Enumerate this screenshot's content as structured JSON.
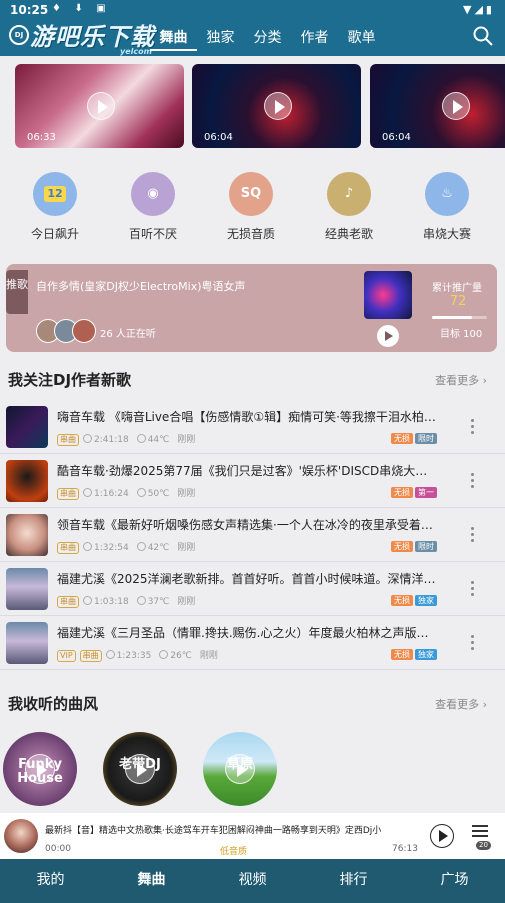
{
  "status_bar": {
    "time": "10:25",
    "left_icons": "♦ ⬇ ▣",
    "right_icons": "▼◢▮"
  },
  "header": {
    "logo_text": "DJ",
    "watermark": "游吧乐下载",
    "watermark_sub": "yelcom",
    "tabs": [
      {
        "label": "舞曲",
        "active": true
      },
      {
        "label": "独家",
        "active": false
      },
      {
        "label": "分类",
        "active": false
      },
      {
        "label": "作者",
        "active": false
      },
      {
        "label": "歌单",
        "active": false
      }
    ]
  },
  "videos": [
    {
      "duration": "06:33"
    },
    {
      "duration": "06:04"
    },
    {
      "duration": "06:04"
    }
  ],
  "categories": [
    {
      "label": "今日飙升",
      "icon": "calendar-12-icon",
      "glyph": "12",
      "color": "#8fb6e8"
    },
    {
      "label": "百听不厌",
      "icon": "vinyl-disc-icon",
      "glyph": "◉",
      "color": "#b9a3d4"
    },
    {
      "label": "无损音质",
      "icon": "sq-headphones-icon",
      "glyph": "SQ",
      "color": "#e3a28a"
    },
    {
      "label": "经典老歌",
      "icon": "gramophone-icon",
      "glyph": "♪",
      "color": "#c9b070"
    },
    {
      "label": "串烧大赛",
      "icon": "flame-icon",
      "glyph": "♨",
      "color": "#8fb6e8"
    }
  ],
  "recommend": {
    "tag": "推歌",
    "title": "自作多情(皇家DJ权少ElectroMix)粤语女声",
    "listening": "26 人正在听",
    "stat_label": "累计推广量",
    "stat_value": "72",
    "target": "目标 100",
    "progress": 0.72
  },
  "followed": {
    "title": "我关注DJ作者新歌",
    "more": "查看更多"
  },
  "songs": [
    {
      "title": "嗨音车载 《嗨音Live合唱【伤感情歌①辑】痴情可笑·等我擦干泪水柏林...",
      "badge": "串曲",
      "duration": "2:41:18",
      "temp": "44℃",
      "time": "刚刚",
      "tags": [
        {
          "t": "无损",
          "c": "#f08a4b"
        },
        {
          "t": "限时",
          "c": "#6b8fa8"
        }
      ]
    },
    {
      "title": "酷音车载·劲爆2025第77届《我们只是过客》'娱乐杯'DISCD串烧大赛·Dj...",
      "badge": "串曲",
      "duration": "1:16:24",
      "temp": "50℃",
      "time": "刚刚",
      "tags": [
        {
          "t": "无损",
          "c": "#f08a4b"
        },
        {
          "t": "第一",
          "c": "#c8509a"
        }
      ]
    },
    {
      "title": "领音车载《最新好听烟嗓伤感女声精选集·一个人在冰冷的夜里承受着孤...",
      "badge": "串曲",
      "duration": "1:32:54",
      "temp": "42℃",
      "time": "刚刚",
      "tags": [
        {
          "t": "无损",
          "c": "#f08a4b"
        },
        {
          "t": "限时",
          "c": "#6b8fa8"
        }
      ]
    },
    {
      "title": "福建尤溪《2025洋澜老歌新排。首首好听。首首小时候味道。深情洋澜...",
      "badge": "串曲",
      "duration": "1:03:18",
      "temp": "37℃",
      "time": "刚刚",
      "tags": [
        {
          "t": "无损",
          "c": "#f08a4b"
        },
        {
          "t": "独家",
          "c": "#3a9ad9"
        }
      ]
    },
    {
      "title": "福建尤溪《三月圣品（情罪.搀扶.赐伤.心之火）年度最火柏林之声版（...",
      "badge": "串曲",
      "duration": "1:23:35",
      "temp": "26℃",
      "time": "刚刚",
      "tags": [
        {
          "t": "无损",
          "c": "#f08a4b"
        },
        {
          "t": "独家",
          "c": "#3a9ad9"
        }
      ],
      "vip": "VIP"
    }
  ],
  "genres_section": {
    "title": "我收听的曲风",
    "more": "查看更多"
  },
  "genres": [
    {
      "label": "Funky House"
    },
    {
      "label": "老带DJ"
    },
    {
      "label": "草原"
    }
  ],
  "player": {
    "title": "最新抖【音】精选中文热歌集·长途驾车开车犯困解闷神曲一路畅享到天明》定西Dj小",
    "time_start": "00:00",
    "quality": "低音质",
    "time_end": "76:13",
    "queue_count": "20"
  },
  "bottom_nav": [
    {
      "label": "我的",
      "active": false
    },
    {
      "label": "舞曲",
      "active": true
    },
    {
      "label": "视频",
      "active": false
    },
    {
      "label": "排行",
      "active": false
    },
    {
      "label": "广场",
      "active": false
    }
  ]
}
